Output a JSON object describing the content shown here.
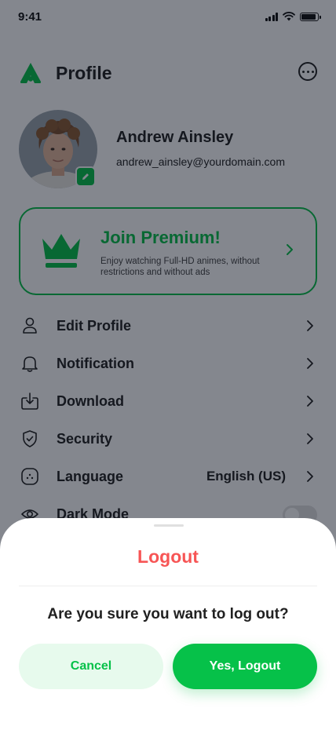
{
  "status_bar": {
    "time": "9:41"
  },
  "header": {
    "title": "Profile",
    "logo_icon": "app-logo-icon",
    "more_icon": "more-horizontal-icon"
  },
  "user": {
    "name": "Andrew Ainsley",
    "email": "andrew_ainsley@yourdomain.com"
  },
  "premium": {
    "title": "Join Premium!",
    "description": "Enjoy watching Full-HD animes, without restrictions and without ads"
  },
  "menu": {
    "items": [
      {
        "label": "Edit Profile",
        "icon": "user-icon"
      },
      {
        "label": "Notification",
        "icon": "bell-icon"
      },
      {
        "label": "Download",
        "icon": "download-icon"
      },
      {
        "label": "Security",
        "icon": "shield-check-icon"
      },
      {
        "label": "Language",
        "icon": "language-icon",
        "value": "English (US)"
      },
      {
        "label": "Dark Mode",
        "icon": "eye-icon",
        "toggle": false
      }
    ]
  },
  "logout_sheet": {
    "title": "Logout",
    "question": "Are you sure you want to log out?",
    "cancel_label": "Cancel",
    "confirm_label": "Yes, Logout"
  },
  "colors": {
    "primary": "#06C149",
    "danger": "#F75555",
    "cancel_bg": "#E7FAED",
    "overlay": "#09101D"
  }
}
